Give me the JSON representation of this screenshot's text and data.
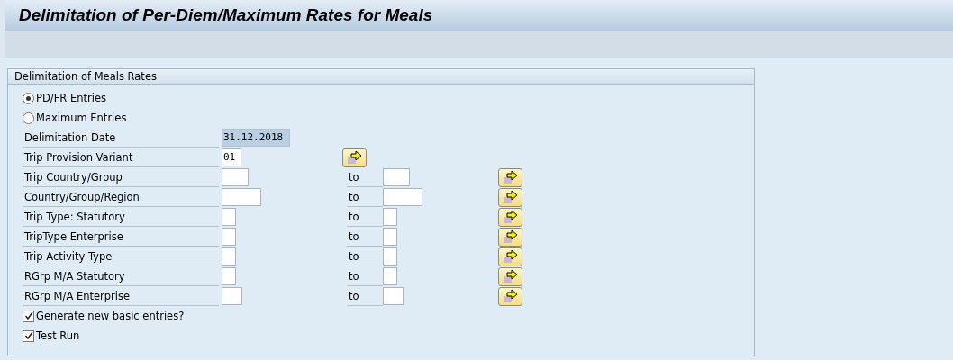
{
  "window": {
    "title": "Delimitation of Per-Diem/Maximum Rates for Meals"
  },
  "group": {
    "title": "Delimitation of Meals Rates",
    "radios": [
      {
        "label": "PD/FR Entries",
        "selected": true
      },
      {
        "label": "Maximum Entries",
        "selected": false
      }
    ],
    "date": {
      "label": "Delimitation Date",
      "value": "31.12.2018"
    },
    "variant": {
      "label": "Trip Provision Variant",
      "value": "01"
    },
    "ranges": [
      {
        "label": "Trip Country/Group",
        "to": "to"
      },
      {
        "label": "Country/Group/Region",
        "to": "to"
      },
      {
        "label": "Trip Type: Statutory",
        "to": "to"
      },
      {
        "label": "TripType Enterprise",
        "to": "to"
      },
      {
        "label": "Trip Activity Type",
        "to": "to"
      },
      {
        "label": "RGrp M/A Statutory",
        "to": "to"
      },
      {
        "label": "RGrp M/A Enterprise",
        "to": "to"
      }
    ],
    "checkboxes": [
      {
        "label": "Generate new basic entries?",
        "checked": true
      },
      {
        "label": "Test Run",
        "checked": true
      }
    ]
  }
}
